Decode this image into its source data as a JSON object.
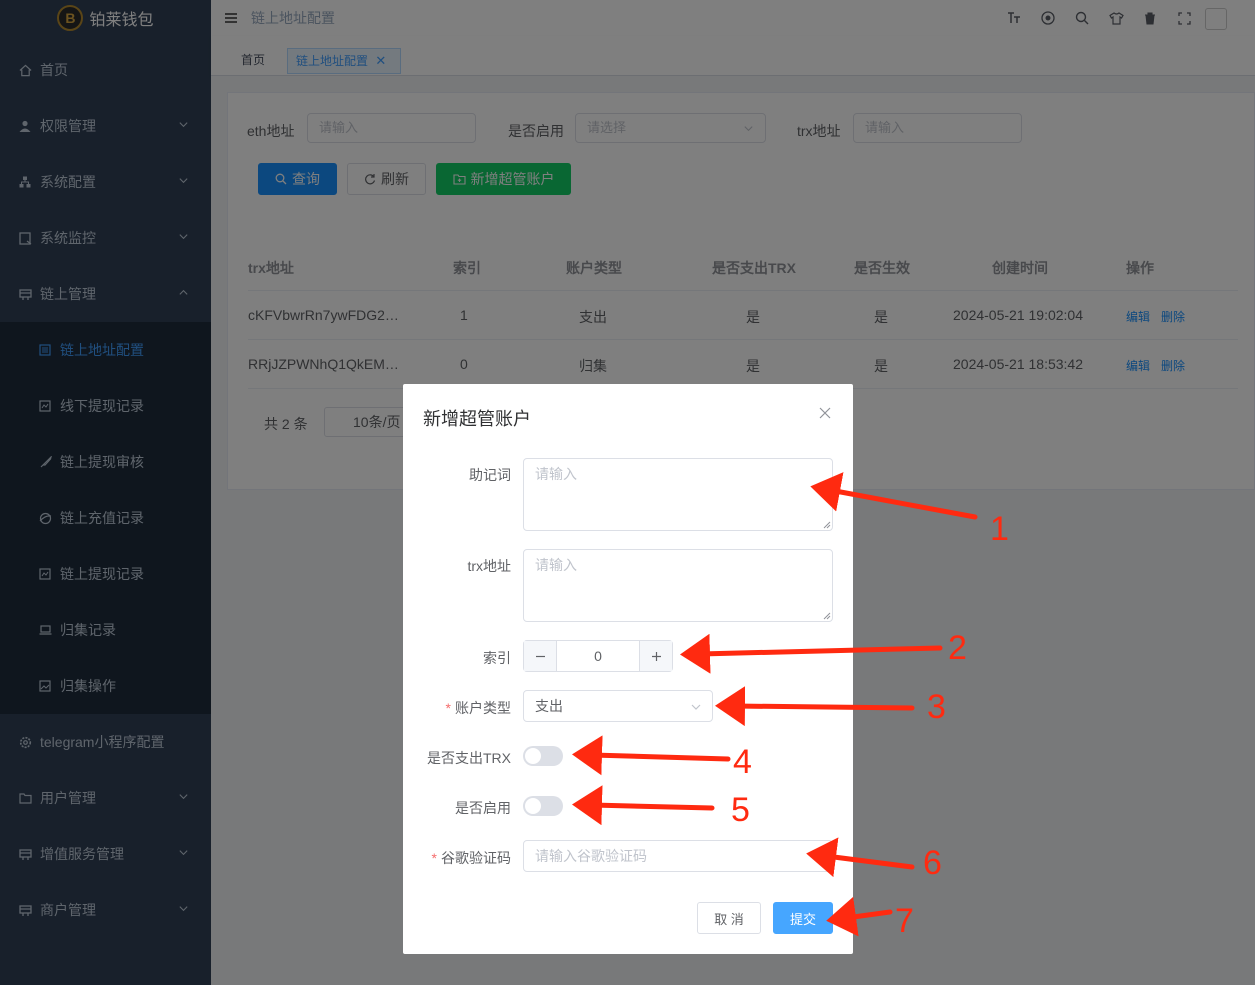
{
  "app": {
    "title": "铂莱钱包",
    "logo_glyph": "B"
  },
  "sidebar": {
    "items": [
      {
        "label": "首页",
        "icon": "home-icon"
      },
      {
        "label": "权限管理",
        "icon": "user-icon"
      },
      {
        "label": "系统配置",
        "icon": "tree-icon"
      },
      {
        "label": "系统监控",
        "icon": "monitor-icon"
      },
      {
        "label": "链上管理",
        "icon": "chain-icon"
      },
      {
        "label": "链上地址配置",
        "icon": "list-icon"
      },
      {
        "label": "线下提现记录",
        "icon": "chart-icon"
      },
      {
        "label": "链上提现审核",
        "icon": "rocket-icon"
      },
      {
        "label": "链上充值记录",
        "icon": "globe-icon"
      },
      {
        "label": "链上提现记录",
        "icon": "chart-icon"
      },
      {
        "label": "归集记录",
        "icon": "laptop-icon"
      },
      {
        "label": "归集操作",
        "icon": "image-icon"
      },
      {
        "label": "telegram小程序配置",
        "icon": "gear-icon"
      },
      {
        "label": "用户管理",
        "icon": "folder-icon"
      },
      {
        "label": "增值服务管理",
        "icon": "chain-icon"
      },
      {
        "label": "商户管理",
        "icon": "chain-icon"
      }
    ]
  },
  "header": {
    "breadcrumb": "链上地址配置"
  },
  "tabs": [
    {
      "label": "首页"
    },
    {
      "label": "链上地址配置"
    }
  ],
  "filters": {
    "eth_label": "eth地址",
    "eth_placeholder": "请输入",
    "enabled_label": "是否启用",
    "enabled_placeholder": "请选择",
    "trx_label": "trx地址",
    "trx_placeholder": "请输入"
  },
  "toolbar": {
    "query": "查询",
    "refresh": "刷新",
    "add": "新增超管账户"
  },
  "table": {
    "columns": [
      "trx地址",
      "索引",
      "账户类型",
      "是否支出TRX",
      "是否生效",
      "创建时间",
      "操作"
    ],
    "rows": [
      {
        "trx": "cKFVbwrRn7ywFDG2…",
        "index": "1",
        "type": "支出",
        "payout_trx": "是",
        "effective": "是",
        "created": "2024-05-21 19:02:04",
        "edit": "编辑",
        "delete": "删除"
      },
      {
        "trx": "RRjJZPWNhQ1QkEM…",
        "index": "0",
        "type": "归集",
        "payout_trx": "是",
        "effective": "是",
        "created": "2024-05-21 18:53:42",
        "edit": "编辑",
        "delete": "删除"
      }
    ]
  },
  "pager": {
    "total": "共 2 条",
    "page_size": "10条/页"
  },
  "dialog": {
    "title": "新增超管账户",
    "mnemonic_label": "助记词",
    "mnemonic_placeholder": "请输入",
    "trx_label": "trx地址",
    "trx_placeholder": "请输入",
    "index_label": "索引",
    "index_value": "0",
    "type_label": "账户类型",
    "type_value": "支出",
    "payout_label": "是否支出TRX",
    "payout_on": false,
    "enable_label": "是否启用",
    "enable_on": false,
    "google_label": "谷歌验证码",
    "google_placeholder": "请输入谷歌验证码",
    "cancel": "取 消",
    "submit": "提交",
    "required_mark": "*"
  },
  "annotations": {
    "labels": [
      "1",
      "2",
      "3",
      "4",
      "5",
      "6",
      "7"
    ],
    "color": "#ff2a10"
  },
  "colors": {
    "primary": "#1890ff",
    "success": "#13ce66",
    "sidebar_bg": "#304156",
    "active_menu": "#409eff"
  }
}
